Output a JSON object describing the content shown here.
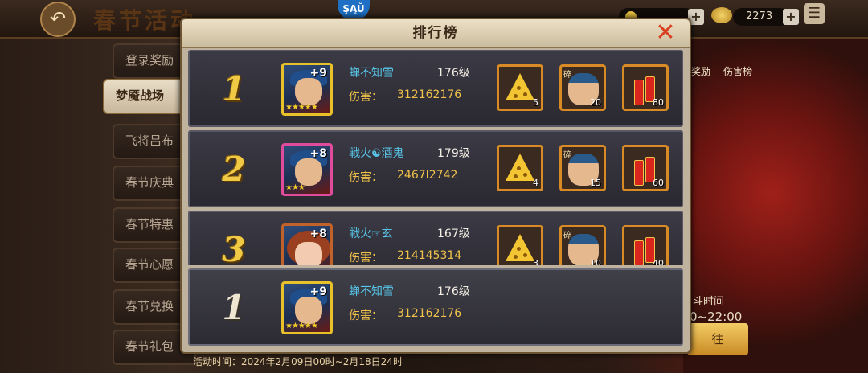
{
  "background": {
    "event_title": "春节活动",
    "top_resources": [
      {
        "icon": "coin-icon",
        "value": ""
      },
      {
        "icon": "gold-ingot-icon",
        "value": "2273"
      }
    ],
    "side_tabs": [
      {
        "label": "登录奖励",
        "active": false
      },
      {
        "label": "梦魇战场",
        "active": true
      },
      {
        "label": "飞将吕布",
        "active": false
      },
      {
        "label": "春节庆典",
        "active": false
      },
      {
        "label": "春节特惠",
        "active": false
      },
      {
        "label": "春节心愿",
        "active": false
      },
      {
        "label": "春节兑换",
        "active": false
      },
      {
        "label": "春节礼包",
        "active": false
      }
    ],
    "right_labels": [
      "奖励",
      "伤害榜"
    ],
    "right_time_label": "斗时间",
    "right_time_value": "0~22:00",
    "right_button_label": "往",
    "activity_time": "活动时间：2024年2月09日00时~2月18日24时"
  },
  "leaderboard": {
    "title": "排行榜",
    "entries": [
      {
        "rank": "1",
        "name": "蝉不知雪",
        "level": "176级",
        "damage_label": "伤害：",
        "damage": "312162176",
        "avatar_plus": "+9",
        "avatar_frame": "gold",
        "rewards": [
          {
            "item": "cheese-token-icon",
            "qty": "5"
          },
          {
            "item": "general-fragment-icon",
            "tag": "碎",
            "qty": "20"
          },
          {
            "item": "firecracker-icon",
            "qty": "80"
          }
        ]
      },
      {
        "rank": "2",
        "name": "戦火☯酒鬼",
        "level": "179级",
        "damage_label": "伤害：",
        "damage": "2467I2742",
        "avatar_plus": "+8",
        "avatar_frame": "pink",
        "rewards": [
          {
            "item": "cheese-token-icon",
            "qty": "4"
          },
          {
            "item": "general-fragment-icon",
            "tag": "碎",
            "qty": "15"
          },
          {
            "item": "firecracker-icon",
            "qty": "60"
          }
        ]
      },
      {
        "rank": "3",
        "name": "戦火☞玄",
        "level": "167级",
        "damage_label": "伤害：",
        "damage": "214145314",
        "avatar_plus": "+8",
        "avatar_frame": "orange",
        "rewards": [
          {
            "item": "cheese-token-icon",
            "qty": "3"
          },
          {
            "item": "general-fragment-icon",
            "tag": "碎",
            "qty": "10"
          },
          {
            "item": "firecracker-icon",
            "qty": "40"
          }
        ]
      }
    ],
    "self": {
      "rank": "1",
      "name": "蝉不知雪",
      "level": "176级",
      "damage_label": "伤害：",
      "damage": "312162176",
      "avatar_plus": "+9"
    }
  },
  "colors": {
    "rank_gold": "#f0c945",
    "name_blue": "#58c6e8",
    "damage_yellow": "#f1c24a"
  }
}
